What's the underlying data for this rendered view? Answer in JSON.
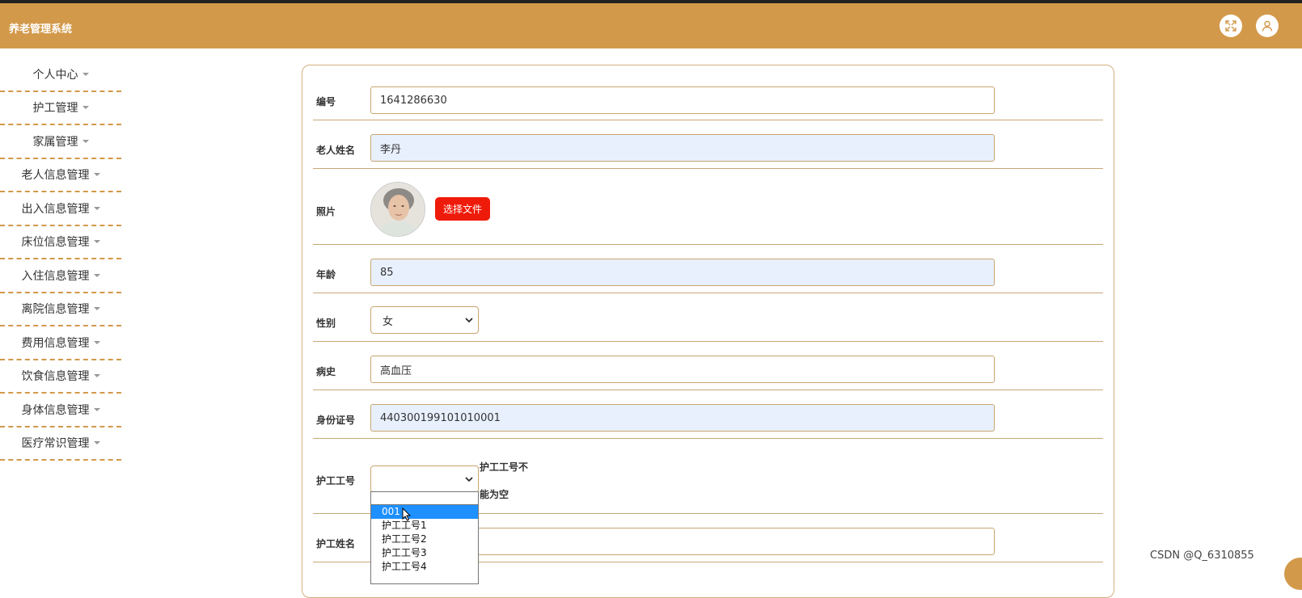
{
  "header": {
    "title": "养老管理系统",
    "icons": [
      "fullscreen-icon",
      "user-icon"
    ]
  },
  "sidebar": {
    "items": [
      {
        "label": "个人中心"
      },
      {
        "label": "护工管理"
      },
      {
        "label": "家属管理"
      },
      {
        "label": "老人信息管理"
      },
      {
        "label": "出入信息管理"
      },
      {
        "label": "床位信息管理"
      },
      {
        "label": "入住信息管理"
      },
      {
        "label": "离院信息管理"
      },
      {
        "label": "费用信息管理"
      },
      {
        "label": "饮食信息管理"
      },
      {
        "label": "身体信息管理"
      },
      {
        "label": "医疗常识管理"
      }
    ]
  },
  "form": {
    "id": {
      "label": "编号",
      "value": "1641286630"
    },
    "name": {
      "label": "老人姓名",
      "value": "李丹"
    },
    "photo": {
      "label": "照片",
      "button": "选择文件"
    },
    "age": {
      "label": "年龄",
      "value": "85"
    },
    "gender": {
      "label": "性别",
      "value": "女"
    },
    "history": {
      "label": "病史",
      "value": "高血压"
    },
    "idcard": {
      "label": "身份证号",
      "value": "440300199101010001"
    },
    "caregiver_no": {
      "label": "护工工号",
      "value": "",
      "error_line1": "护工工号不",
      "error_line2": "能为空",
      "options": [
        "001",
        "护工工号1",
        "护工工号2",
        "护工工号3",
        "护工工号4"
      ],
      "highlighted": "001"
    },
    "caregiver_name": {
      "label": "护工姓名",
      "value": ""
    }
  },
  "watermark": "CSDN @Q_6310855",
  "colors": {
    "brand": "#d3994a",
    "button_red": "#ef1b0a",
    "option_highlight": "#1e90ff"
  }
}
